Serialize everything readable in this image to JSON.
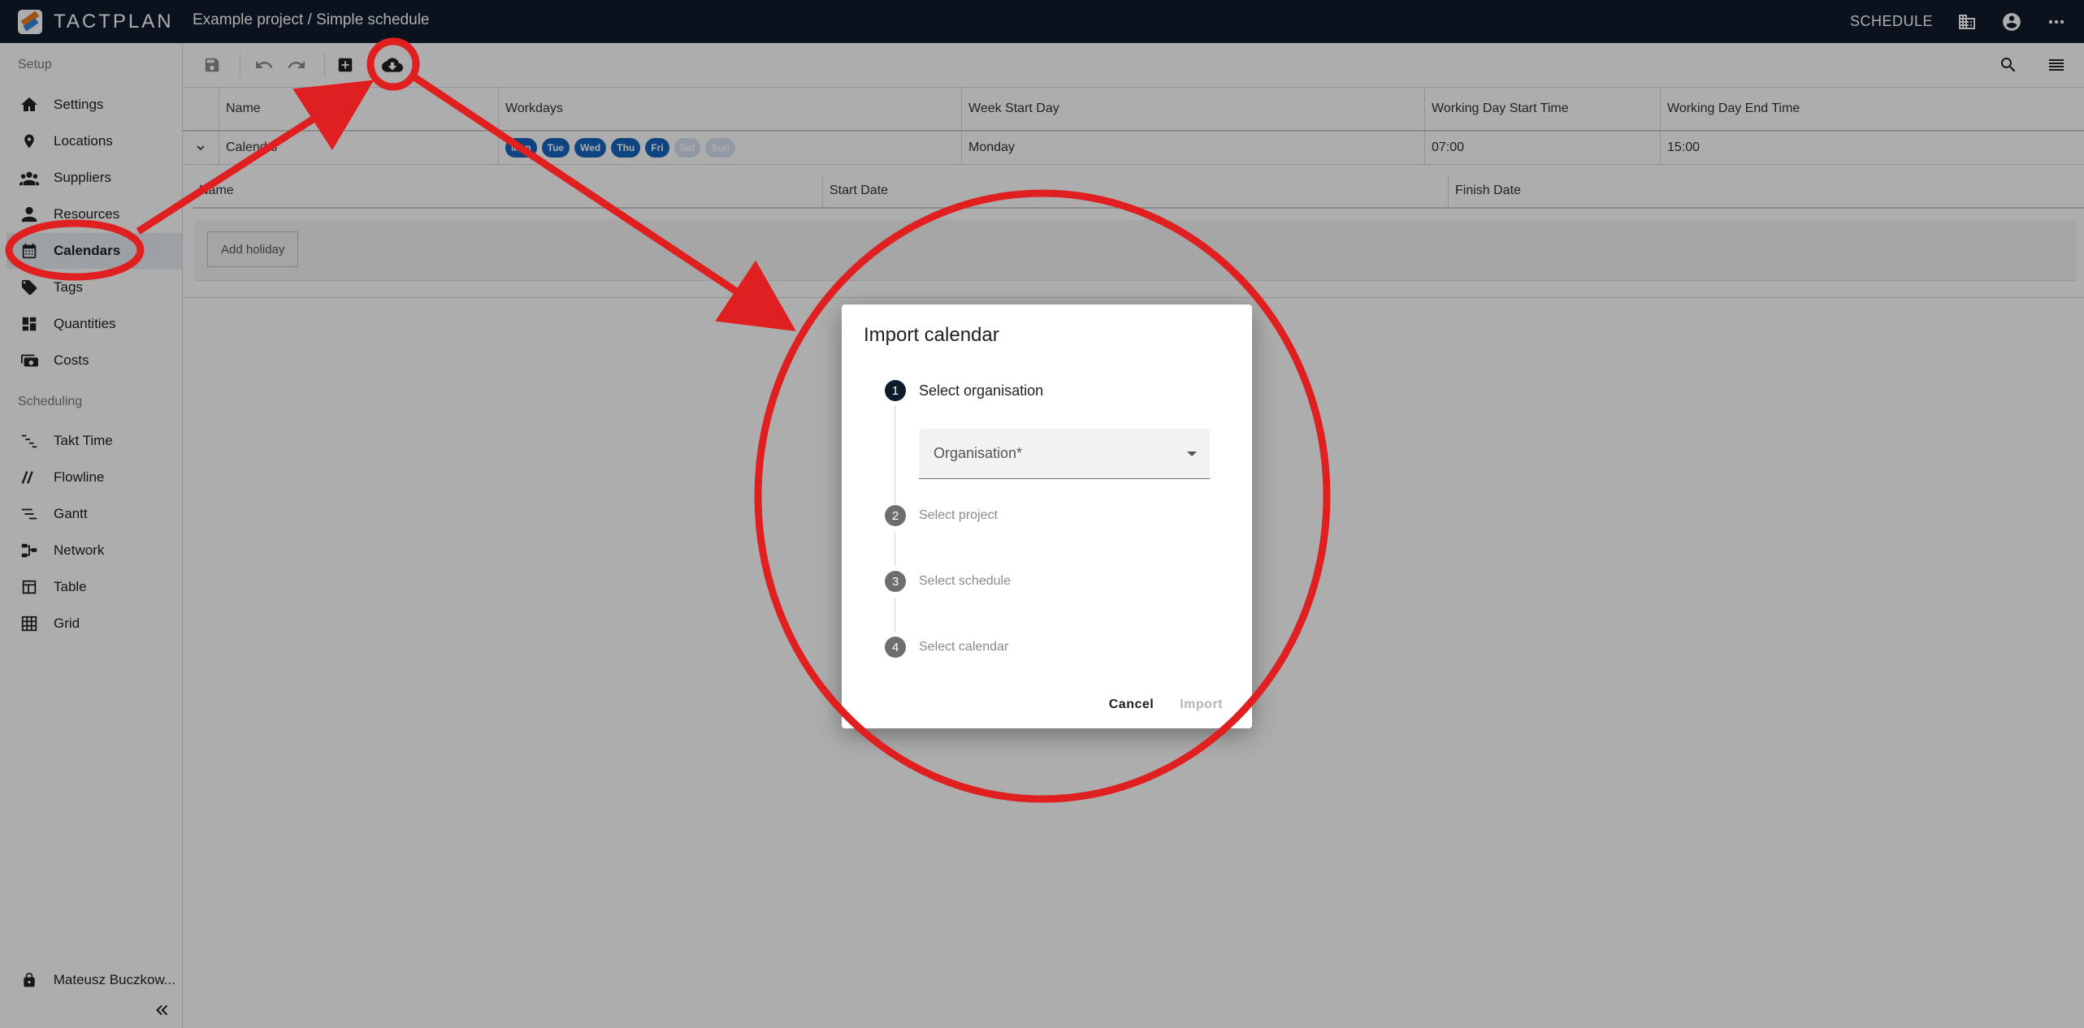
{
  "app": {
    "brand": "TACTPLAN",
    "breadcrumb": "Example project / Simple schedule",
    "mode_label": "SCHEDULE"
  },
  "sidebar": {
    "setup_label": "Setup",
    "scheduling_label": "Scheduling",
    "setup_items": [
      {
        "label": "Settings",
        "icon": "settings-icon"
      },
      {
        "label": "Locations",
        "icon": "location-pin-icon"
      },
      {
        "label": "Suppliers",
        "icon": "group-icon"
      },
      {
        "label": "Resources",
        "icon": "person-icon"
      },
      {
        "label": "Calendars",
        "icon": "calendar-icon"
      },
      {
        "label": "Tags",
        "icon": "tag-icon"
      },
      {
        "label": "Quantities",
        "icon": "dashboard-icon"
      },
      {
        "label": "Costs",
        "icon": "money-icon"
      }
    ],
    "scheduling_items": [
      {
        "label": "Takt Time",
        "icon": "takt-icon"
      },
      {
        "label": "Flowline",
        "icon": "flowline-icon"
      },
      {
        "label": "Gantt",
        "icon": "gantt-icon"
      },
      {
        "label": "Network",
        "icon": "network-icon"
      },
      {
        "label": "Table",
        "icon": "table-icon"
      },
      {
        "label": "Grid",
        "icon": "grid-icon"
      }
    ],
    "user_name": "Mateusz Buczkow..."
  },
  "table": {
    "columns": [
      "Name",
      "Workdays",
      "Week Start Day",
      "Working Day Start Time",
      "Working Day End Time"
    ],
    "row": {
      "name": "Calendar",
      "workdays": [
        {
          "day": "Mon",
          "on": true
        },
        {
          "day": "Tue",
          "on": true
        },
        {
          "day": "Wed",
          "on": true
        },
        {
          "day": "Thu",
          "on": true
        },
        {
          "day": "Fri",
          "on": true
        },
        {
          "day": "Sat",
          "on": false
        },
        {
          "day": "Sun",
          "on": false
        }
      ],
      "week_start": "Monday",
      "start_time": "07:00",
      "end_time": "15:00"
    },
    "holiday_columns": [
      "Name",
      "Start Date",
      "Finish Date"
    ],
    "add_holiday_label": "Add holiday"
  },
  "dialog": {
    "title": "Import calendar",
    "steps": [
      {
        "num": "1",
        "label": "Select organisation"
      },
      {
        "num": "2",
        "label": "Select project"
      },
      {
        "num": "3",
        "label": "Select schedule"
      },
      {
        "num": "4",
        "label": "Select calendar"
      }
    ],
    "organisation_placeholder": "Organisation*",
    "cancel_label": "Cancel",
    "import_label": "Import"
  },
  "colors": {
    "topbar": "#0e1b2c",
    "chip_on": "#1565c0",
    "annotation": "#e02020"
  }
}
